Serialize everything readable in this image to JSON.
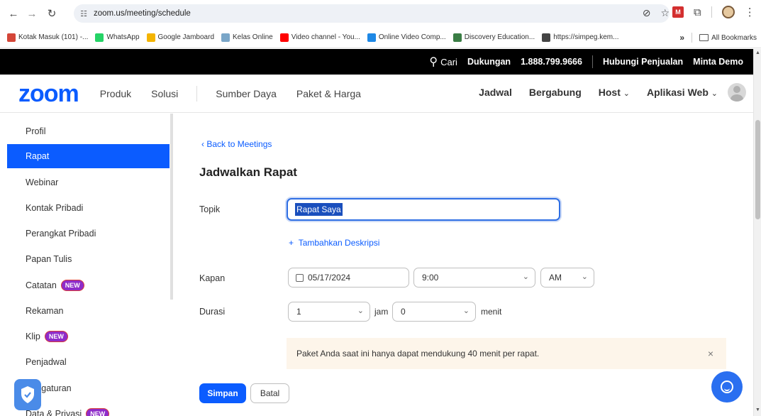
{
  "browser": {
    "url": "zoom.us/meeting/schedule",
    "bookmarks": [
      {
        "label": "Kotak Masuk (101) -...",
        "color": "#d44638"
      },
      {
        "label": "WhatsApp",
        "color": "#25d366"
      },
      {
        "label": "Google Jamboard",
        "color": "#f4b400"
      },
      {
        "label": "Kelas Online",
        "color": "#7aa6c8"
      },
      {
        "label": "Video channel - You...",
        "color": "#ff0000"
      },
      {
        "label": "Online Video Comp...",
        "color": "#1e88e5"
      },
      {
        "label": "Discovery Education...",
        "color": "#3a7d44"
      },
      {
        "label": "https://simpeg.kem...",
        "color": "#444444"
      }
    ],
    "more_bookmarks": "»",
    "all_bookmarks": "All Bookmarks"
  },
  "topbar": {
    "search": "Cari",
    "support": "Dukungan",
    "phone": "1.888.799.9666",
    "contact_sales": "Hubungi Penjualan",
    "request_demo": "Minta Demo"
  },
  "nav": {
    "logo": "zoom",
    "links": [
      "Produk",
      "Solusi",
      "Sumber Daya",
      "Paket & Harga"
    ],
    "right": {
      "schedule": "Jadwal",
      "join": "Bergabung",
      "host": "Host",
      "web_app": "Aplikasi Web"
    }
  },
  "sidebar": {
    "items": [
      {
        "label": "Profil"
      },
      {
        "label": "Rapat"
      },
      {
        "label": "Webinar"
      },
      {
        "label": "Kontak Pribadi"
      },
      {
        "label": "Perangkat Pribadi"
      },
      {
        "label": "Papan Tulis"
      },
      {
        "label": "Catatan",
        "badge": "NEW"
      },
      {
        "label": "Rekaman"
      },
      {
        "label": "Klip",
        "badge": "NEW"
      },
      {
        "label": "Penjadwal"
      },
      {
        "label": "Pengaturan"
      },
      {
        "label": "Data & Privasi",
        "badge": "NEW"
      }
    ]
  },
  "form": {
    "back_link": "Back to Meetings",
    "title": "Jadwalkan Rapat",
    "topic_label": "Topik",
    "topic_value": "Rapat Saya",
    "add_description": "Tambahkan Deskripsi",
    "when_label": "Kapan",
    "date_value": "05/17/2024",
    "time_value": "9:00",
    "ampm_value": "AM",
    "duration_label": "Durasi",
    "hours_value": "1",
    "hours_unit": "jam",
    "minutes_value": "0",
    "minutes_unit": "menit",
    "notice": "Paket Anda saat ini hanya dapat mendukung 40 menit per rapat.",
    "save": "Simpan",
    "cancel": "Batal"
  },
  "colors": {
    "brand": "#0b5cff",
    "badge": "#8e2cc9"
  }
}
